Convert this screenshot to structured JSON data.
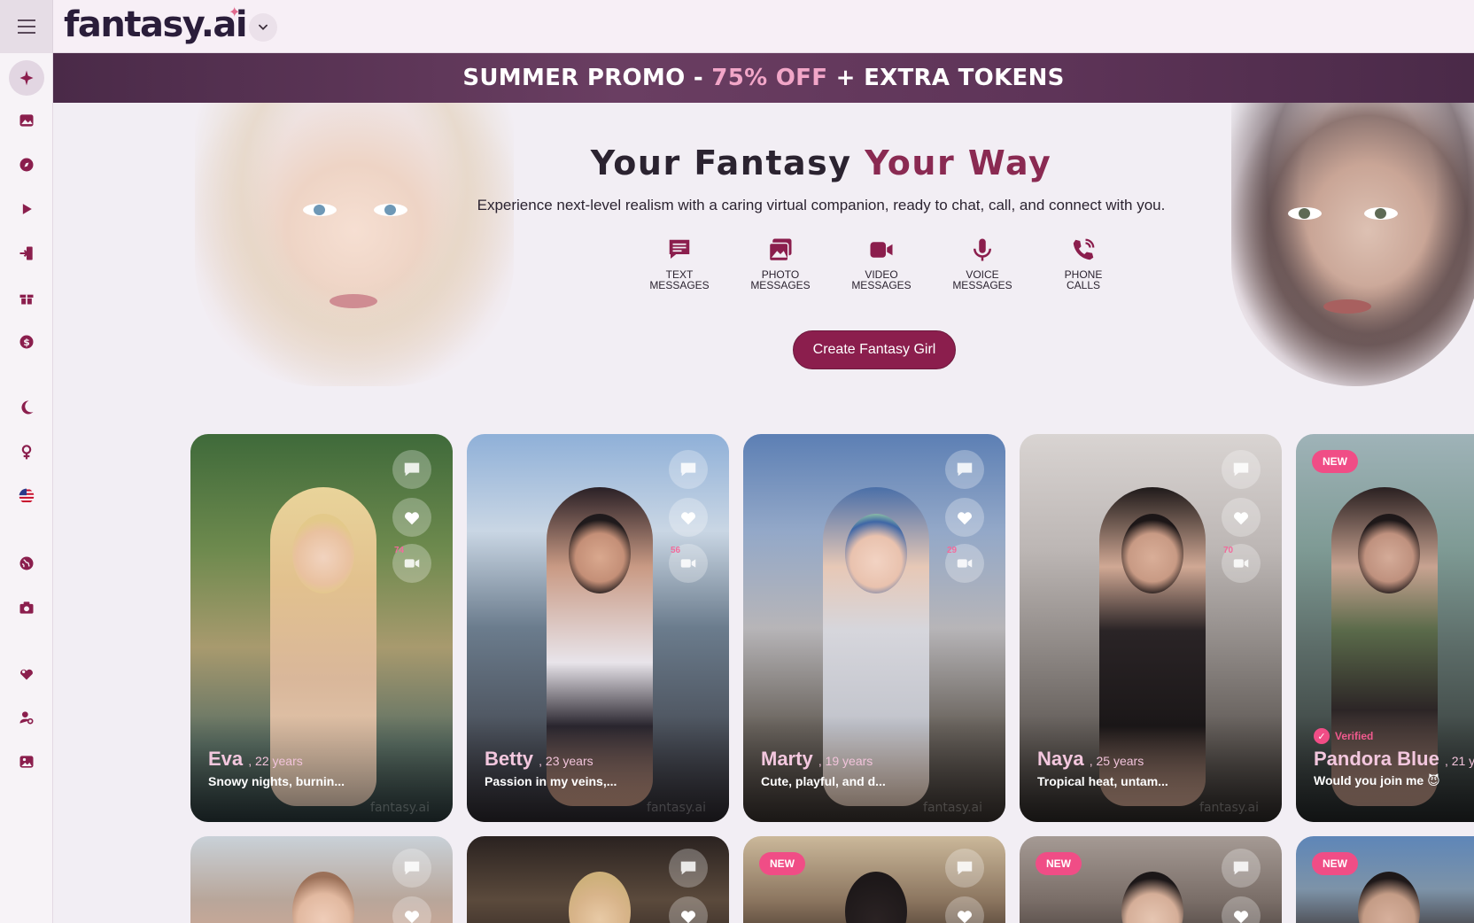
{
  "header": {
    "logo_text": "fantasy.ai",
    "logo_star": "✦",
    "caret": "⌄"
  },
  "promo": {
    "prefix": "SUMMER PROMO - ",
    "highlight": "75% OFF",
    "suffix": " + EXTRA TOKENS"
  },
  "hero": {
    "title_main": "Your Fantasy ",
    "title_accent": "Your Way",
    "subtitle": "Experience next-level realism with a caring virtual companion, ready to chat, call, and connect with you.",
    "features": [
      {
        "icon": "text-messages-icon",
        "line1": "TEXT",
        "line2": "MESSAGES"
      },
      {
        "icon": "photo-messages-icon",
        "line1": "PHOTO",
        "line2": "MESSAGES"
      },
      {
        "icon": "video-messages-icon",
        "line1": "VIDEO",
        "line2": "MESSAGES"
      },
      {
        "icon": "voice-messages-icon",
        "line1": "VOICE",
        "line2": "MESSAGES"
      },
      {
        "icon": "phone-calls-icon",
        "line1": "PHONE",
        "line2": "CALLS"
      }
    ],
    "cta_label": "Create Fantasy Girl"
  },
  "sidebar": {
    "items": [
      {
        "icon": "sparkle-icon"
      },
      {
        "icon": "gallery-icon"
      },
      {
        "icon": "compass-icon"
      },
      {
        "icon": "play-icon"
      },
      {
        "icon": "login-icon"
      },
      {
        "icon": "gift-icon"
      },
      {
        "icon": "dollar-icon"
      },
      {
        "icon": "moon-icon"
      },
      {
        "icon": "female-icon"
      },
      {
        "icon": "us-flag-icon"
      },
      {
        "icon": "globe-icon"
      },
      {
        "icon": "camera-icon"
      },
      {
        "icon": "hearts-icon"
      },
      {
        "icon": "user-search-icon"
      },
      {
        "icon": "image-icon"
      }
    ]
  },
  "cards": [
    {
      "name": "Eva",
      "age": ", 22 years",
      "desc": "Snowy nights, burnin...",
      "video_count": "74",
      "watermark": "fantasy.ai"
    },
    {
      "name": "Betty",
      "age": ", 23 years",
      "desc": "Passion in my veins,...",
      "video_count": "56",
      "watermark": "fantasy.ai"
    },
    {
      "name": "Marty",
      "age": ", 19 years",
      "desc": "Cute, playful, and d...",
      "video_count": "29",
      "watermark": "fantasy.ai"
    },
    {
      "name": "Naya",
      "age": ", 25 years",
      "desc": "Tropical heat, untam...",
      "video_count": "70",
      "watermark": "fantasy.ai"
    },
    {
      "name": "Pandora Blue",
      "age": ", 21 y",
      "desc": "Would you join me 😈",
      "badge": "NEW",
      "verified": "Verified"
    }
  ],
  "cards_row2": [
    {
      "badge": ""
    },
    {
      "badge": ""
    },
    {
      "badge": "NEW"
    },
    {
      "badge": "NEW"
    },
    {
      "badge": "NEW"
    }
  ],
  "colors": {
    "brand": "#8b1e4d",
    "accent_pink": "#f04d86",
    "promo_highlight": "#f2a6c8"
  }
}
